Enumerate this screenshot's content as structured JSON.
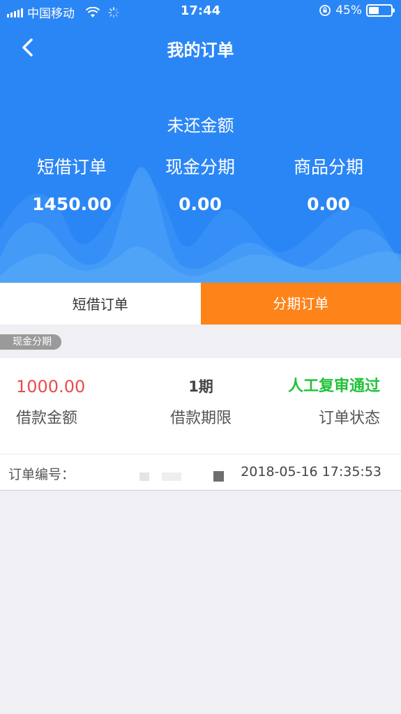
{
  "status_bar": {
    "carrier": "中国移动",
    "time": "17:44",
    "battery": "45%",
    "battery_level": 0.45
  },
  "nav": {
    "title": "我的订单",
    "back_icon": "chevron-left-icon"
  },
  "summary": {
    "heading": "未还金额",
    "columns": [
      {
        "label": "短借订单",
        "value": "1450.00"
      },
      {
        "label": "现金分期",
        "value": "0.00"
      },
      {
        "label": "商品分期",
        "value": "0.00"
      }
    ]
  },
  "tabs": [
    {
      "label": "短借订单",
      "active": false
    },
    {
      "label": "分期订单",
      "active": true
    }
  ],
  "section_badge": "现金分期",
  "order": {
    "amount": "1000.00",
    "amount_label": "借款金额",
    "term": "1期",
    "term_label": "借款期限",
    "status": "人工复审通过",
    "status_label": "订单状态",
    "number_label": "订单编号：",
    "number_visible": "0115",
    "time": "2018-05-16 17:35:53"
  },
  "colors": {
    "header_blue": "#2b86f5",
    "active_tab_orange": "#fe8319",
    "amount_red": "#e74c4c",
    "status_green": "#22c13a"
  }
}
